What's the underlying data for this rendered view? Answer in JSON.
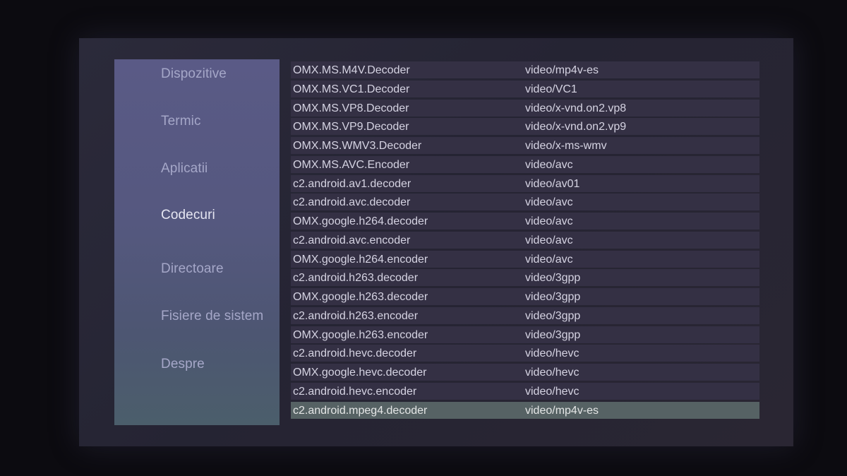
{
  "sidebar": {
    "items": [
      {
        "label": "Dispozitive",
        "active": false
      },
      {
        "label": "Termic",
        "active": false
      },
      {
        "label": "Aplicatii",
        "active": false
      },
      {
        "label": "Codecuri",
        "active": true
      },
      {
        "label": "Directoare",
        "active": false
      },
      {
        "label": "Fisiere de sistem",
        "active": false
      },
      {
        "label": "Despre",
        "active": false
      }
    ]
  },
  "codecs": [
    {
      "name": "OMX.MS.M4V.Decoder",
      "type": "video/mp4v-es"
    },
    {
      "name": "OMX.MS.VC1.Decoder",
      "type": "video/VC1"
    },
    {
      "name": "OMX.MS.VP8.Decoder",
      "type": "video/x-vnd.on2.vp8"
    },
    {
      "name": "OMX.MS.VP9.Decoder",
      "type": "video/x-vnd.on2.vp9"
    },
    {
      "name": "OMX.MS.WMV3.Decoder",
      "type": "video/x-ms-wmv"
    },
    {
      "name": "OMX.MS.AVC.Encoder",
      "type": "video/avc"
    },
    {
      "name": "c2.android.av1.decoder",
      "type": "video/av01"
    },
    {
      "name": "c2.android.avc.decoder",
      "type": "video/avc"
    },
    {
      "name": "OMX.google.h264.decoder",
      "type": "video/avc"
    },
    {
      "name": "c2.android.avc.encoder",
      "type": "video/avc"
    },
    {
      "name": "OMX.google.h264.encoder",
      "type": "video/avc"
    },
    {
      "name": "c2.android.h263.decoder",
      "type": "video/3gpp"
    },
    {
      "name": "OMX.google.h263.decoder",
      "type": "video/3gpp"
    },
    {
      "name": "c2.android.h263.encoder",
      "type": "video/3gpp"
    },
    {
      "name": "OMX.google.h263.encoder",
      "type": "video/3gpp"
    },
    {
      "name": "c2.android.hevc.decoder",
      "type": "video/hevc"
    },
    {
      "name": "OMX.google.hevc.decoder",
      "type": "video/hevc"
    },
    {
      "name": "c2.android.hevc.encoder",
      "type": "video/hevc"
    },
    {
      "name": "c2.android.mpeg4.decoder",
      "type": "video/mp4v-es",
      "selected": true
    }
  ]
}
